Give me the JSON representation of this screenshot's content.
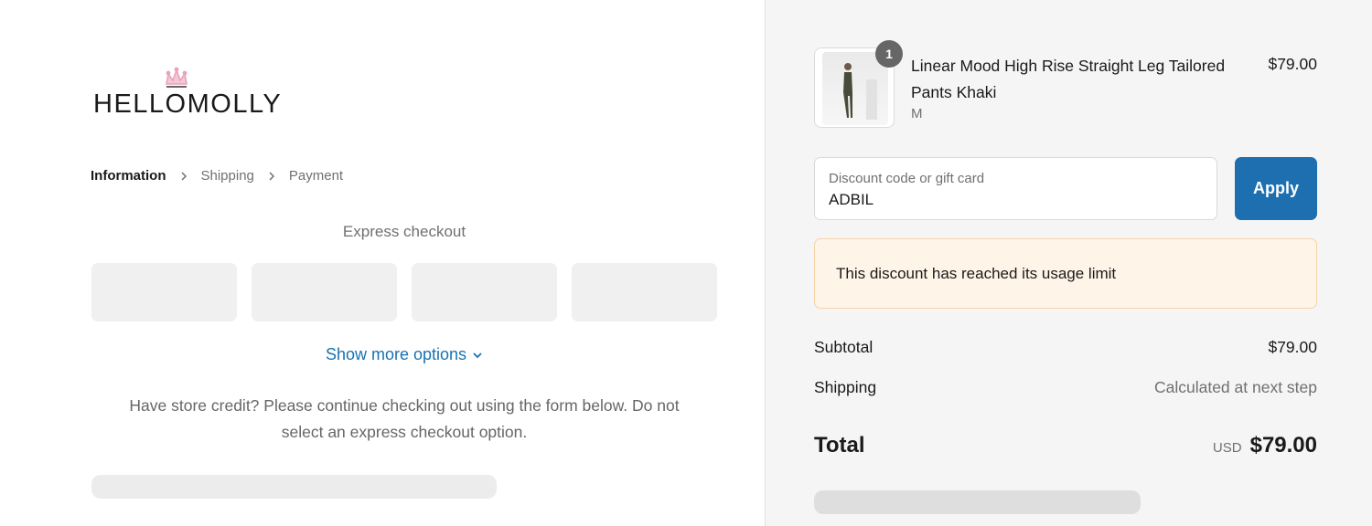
{
  "brand": {
    "name": "HELLOMOLLY",
    "crown_color": "#e8a2bd"
  },
  "breadcrumb": {
    "items": [
      {
        "label": "Information",
        "active": true
      },
      {
        "label": "Shipping",
        "active": false
      },
      {
        "label": "Payment",
        "active": false
      }
    ]
  },
  "express": {
    "title": "Express checkout",
    "show_more": "Show more options",
    "credit_note": "Have store credit? Please continue checking out using the form below. Do not select an express checkout option."
  },
  "cart": {
    "item": {
      "quantity": "1",
      "name": "Linear Mood High Rise Straight Leg Tailored Pants Khaki",
      "variant": "M",
      "price": "$79.00"
    }
  },
  "discount": {
    "placeholder": "Discount code or gift card",
    "value": "ADBIL",
    "apply_label": "Apply",
    "error": "This discount has reached its usage limit"
  },
  "summary": {
    "subtotal_label": "Subtotal",
    "subtotal_value": "$79.00",
    "shipping_label": "Shipping",
    "shipping_value": "Calculated at next step",
    "total_label": "Total",
    "currency": "USD",
    "total_value": "$79.00"
  },
  "colors": {
    "accent": "#1773b0",
    "apply_button": "#1d6fb0",
    "alert_bg": "#fff4e8",
    "alert_border": "#f6d3a6",
    "sidebar_bg": "#f5f5f5"
  }
}
